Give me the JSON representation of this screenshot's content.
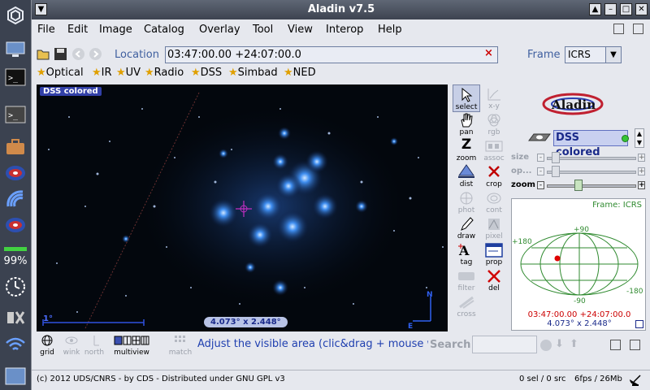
{
  "window": {
    "title": "Aladin v7.5"
  },
  "menu": [
    "File",
    "Edit",
    "Image",
    "Catalog",
    "Overlay",
    "Tool",
    "View",
    "Interop",
    "Help"
  ],
  "location": {
    "label": "Location",
    "value": "03:47:00.00 +24:07:00.0",
    "clear": "×"
  },
  "frame": {
    "label": "Frame",
    "value": "ICRS"
  },
  "surveys": [
    "Optical",
    "IR",
    "UV",
    "Radio",
    "DSS",
    "Simbad",
    "NED"
  ],
  "view": {
    "plane_label": "DSS colored",
    "scale": "1°",
    "fov": "4.073° x 2.448°",
    "north": "N",
    "east": "E"
  },
  "tools": [
    {
      "name": "select",
      "label": "select"
    },
    {
      "name": "xy",
      "label": "x-y"
    },
    {
      "name": "pan",
      "label": "pan"
    },
    {
      "name": "rgb",
      "label": "rgb"
    },
    {
      "name": "zoom",
      "label": "zoom"
    },
    {
      "name": "assoc",
      "label": "assoc"
    },
    {
      "name": "dist",
      "label": "dist"
    },
    {
      "name": "crop",
      "label": "crop"
    },
    {
      "name": "phot",
      "label": "phot"
    },
    {
      "name": "cont",
      "label": "cont"
    },
    {
      "name": "draw",
      "label": "draw"
    },
    {
      "name": "pixel",
      "label": "pixel"
    },
    {
      "name": "tag",
      "label": "tag"
    },
    {
      "name": "prop",
      "label": "prop"
    },
    {
      "name": "filter",
      "label": "filter"
    },
    {
      "name": "del",
      "label": "del"
    },
    {
      "name": "cross",
      "label": "cross"
    }
  ],
  "plane": {
    "name": "DSS colored"
  },
  "sliders": {
    "size": "size",
    "opacity": "op...",
    "zoom": "zoom",
    "minus": "-",
    "plus": "+"
  },
  "locator": {
    "frame": "Frame: ICRS",
    "top": "+90",
    "bottom": "-90",
    "left": "+180",
    "right": "-180",
    "coord": "03:47:00.00 +24:07:00.0",
    "fov": "4.073° x 2.448°"
  },
  "bottom": {
    "tools": [
      "grid",
      "wink",
      "north",
      "multiview",
      "match"
    ],
    "hint": "Adjust the visible area (clic&drag + mouse wheel)",
    "search": "Search"
  },
  "status": {
    "copyright": "(c) 2012 UDS/CNRS - by CDS - Distributed under GNU GPL v3",
    "selection": "0 sel / 0 src",
    "perf": "6fps / 26Mb"
  },
  "dock": {
    "battery": "99%"
  },
  "colors": {
    "accent": "#3f5f9f",
    "plane": "#3240a8",
    "locator_grid": "#2f8a2f"
  }
}
